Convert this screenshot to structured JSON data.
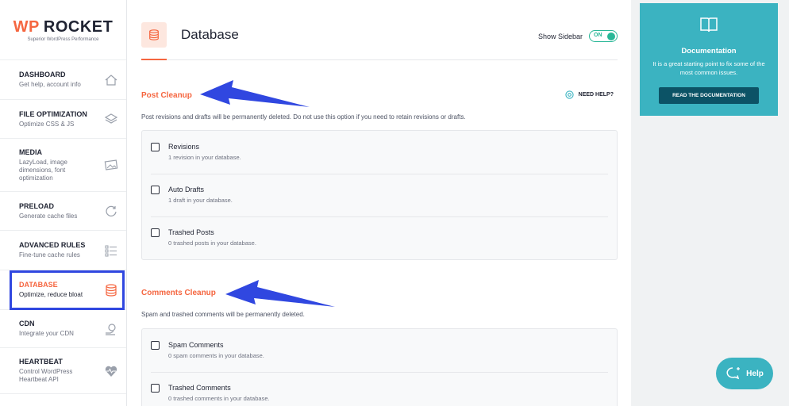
{
  "brand": {
    "logo_wp": "WP",
    "logo_rocket": "ROCKET",
    "tagline": "Superior WordPress Performance"
  },
  "sidebar": {
    "items": [
      {
        "title": "DASHBOARD",
        "desc": "Get help, account info",
        "icon": "home-icon"
      },
      {
        "title": "FILE OPTIMIZATION",
        "desc": "Optimize CSS & JS",
        "icon": "layers-icon"
      },
      {
        "title": "MEDIA",
        "desc": "LazyLoad, image dimensions, font optimization",
        "icon": "image-icon"
      },
      {
        "title": "PRELOAD",
        "desc": "Generate cache files",
        "icon": "refresh-icon"
      },
      {
        "title": "ADVANCED RULES",
        "desc": "Fine-tune cache rules",
        "icon": "list-icon"
      },
      {
        "title": "DATABASE",
        "desc": "Optimize, reduce bloat",
        "icon": "database-icon",
        "active": true
      },
      {
        "title": "CDN",
        "desc": "Integrate your CDN",
        "icon": "cdn-icon"
      },
      {
        "title": "HEARTBEAT",
        "desc": "Control WordPress Heartbeat API",
        "icon": "heartbeat-icon"
      }
    ]
  },
  "header": {
    "title": "Database",
    "show_sidebar_label": "Show Sidebar",
    "toggle_label": "ON"
  },
  "post_cleanup": {
    "title": "Post Cleanup",
    "help_label": "NEED HELP?",
    "description": "Post revisions and drafts will be permanently deleted. Do not use this option if you need to retain revisions or drafts.",
    "options": [
      {
        "label": "Revisions",
        "sub": "1 revision in your database."
      },
      {
        "label": "Auto Drafts",
        "sub": "1 draft in your database."
      },
      {
        "label": "Trashed Posts",
        "sub": "0 trashed posts in your database."
      }
    ]
  },
  "comments_cleanup": {
    "title": "Comments Cleanup",
    "description": "Spam and trashed comments will be permanently deleted.",
    "options": [
      {
        "label": "Spam Comments",
        "sub": "0 spam comments in your database."
      },
      {
        "label": "Trashed Comments",
        "sub": "0 trashed comments in your database."
      }
    ]
  },
  "documentation": {
    "title": "Documentation",
    "text": "It is a great starting point to fix some of the most common issues.",
    "button_label": "READ THE DOCUMENTATION"
  },
  "help_button": {
    "label": "Help"
  },
  "colors": {
    "accent": "#f56640",
    "teal": "#3bb3c1",
    "toggle_green": "#29b797",
    "annotation_blue": "#3047e0"
  }
}
